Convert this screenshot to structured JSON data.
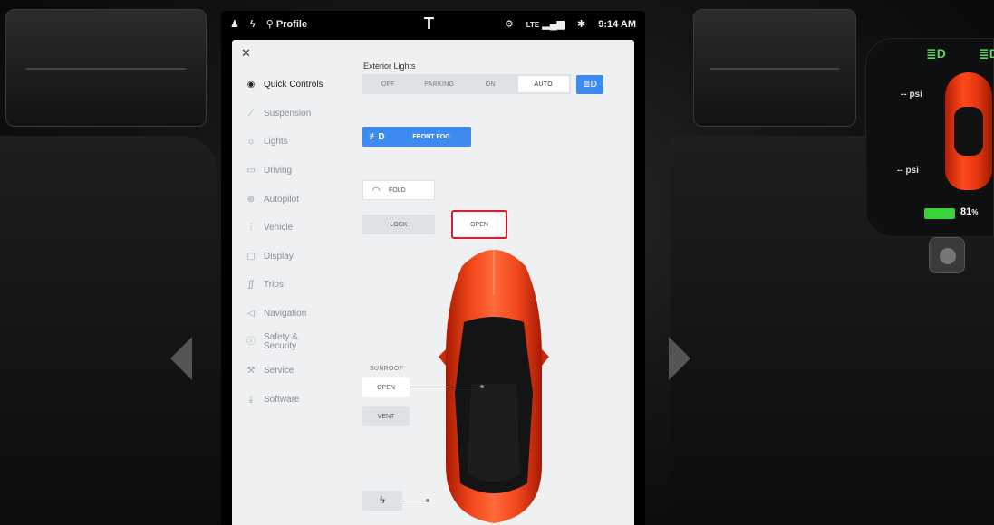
{
  "status_bar": {
    "profile_label": "Profile",
    "network": "LTE",
    "time": "9:14 AM"
  },
  "menu": {
    "items": [
      {
        "label": "Quick Controls",
        "icon": "quick-controls-icon",
        "active": true
      },
      {
        "label": "Suspension",
        "icon": "suspension-icon"
      },
      {
        "label": "Lights",
        "icon": "lights-icon"
      },
      {
        "label": "Driving",
        "icon": "car-icon"
      },
      {
        "label": "Autopilot",
        "icon": "steering-wheel-icon"
      },
      {
        "label": "Vehicle",
        "icon": "sliders-icon"
      },
      {
        "label": "Display",
        "icon": "display-icon"
      },
      {
        "label": "Trips",
        "icon": "trips-icon"
      },
      {
        "label": "Navigation",
        "icon": "navigation-icon"
      },
      {
        "label_line1": "Safety &",
        "label_line2": "Security",
        "icon": "info-icon"
      },
      {
        "label": "Service",
        "icon": "wrench-icon"
      },
      {
        "label": "Software",
        "icon": "download-icon"
      }
    ]
  },
  "quick_controls": {
    "exterior_lights_title": "Exterior Lights",
    "light_modes": [
      "OFF",
      "PARKING",
      "ON",
      "AUTO"
    ],
    "selected_light_mode": "AUTO",
    "front_fog_label": "FRONT FOG",
    "fold_label": "FOLD",
    "lock_label": "LOCK",
    "trunk_open_label": "OPEN",
    "sunroof_label": "SUNROOF",
    "sunroof_open_label": "OPEN",
    "sunroof_vent_label": "VENT"
  },
  "cluster": {
    "tire_pressure_front": "-- psi",
    "tire_pressure_rear": "-- psi",
    "battery_percent": "81",
    "battery_unit": "%"
  },
  "colors": {
    "accent_blue": "#3d8bf0",
    "highlight_red": "#d21f2b",
    "car_red": "#ff4a1a"
  }
}
